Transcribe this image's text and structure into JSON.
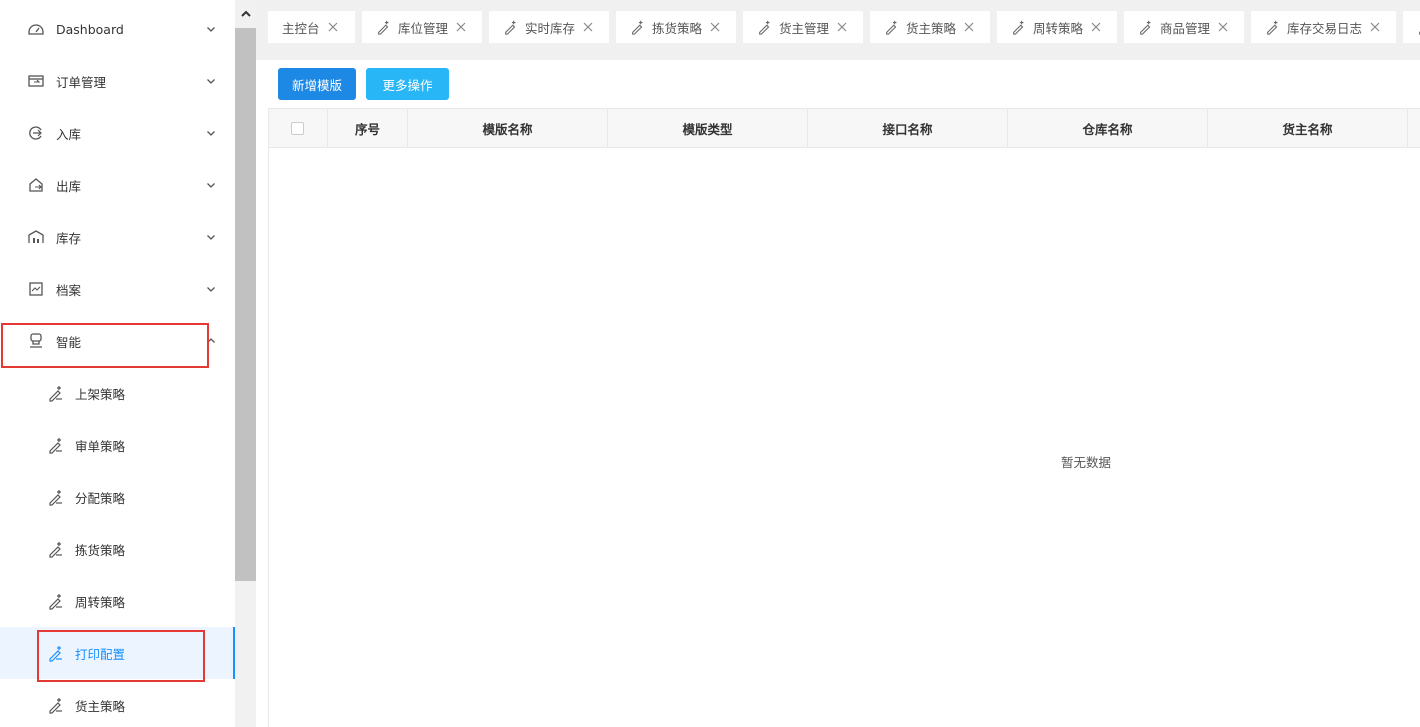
{
  "sidebar": {
    "menu": [
      {
        "label": "Dashboard",
        "icon": "dashboard-icon"
      },
      {
        "label": "订单管理",
        "icon": "order-icon"
      },
      {
        "label": "入库",
        "icon": "inbound-icon"
      },
      {
        "label": "出库",
        "icon": "outbound-icon"
      },
      {
        "label": "库存",
        "icon": "inventory-icon"
      },
      {
        "label": "档案",
        "icon": "archive-icon"
      },
      {
        "label": "智能",
        "icon": "smart-icon"
      }
    ],
    "submenu": [
      {
        "label": "上架策略"
      },
      {
        "label": "审单策略"
      },
      {
        "label": "分配策略"
      },
      {
        "label": "拣货策略"
      },
      {
        "label": "周转策略"
      },
      {
        "label": "打印配置"
      },
      {
        "label": "货主策略"
      }
    ]
  },
  "tabs": [
    {
      "label": "主控台"
    },
    {
      "label": "库位管理"
    },
    {
      "label": "实时库存"
    },
    {
      "label": "拣货策略"
    },
    {
      "label": "货主管理"
    },
    {
      "label": "货主策略"
    },
    {
      "label": "周转策略"
    },
    {
      "label": "商品管理"
    },
    {
      "label": "库存交易日志"
    }
  ],
  "toolbar": {
    "add_label": "新增模版",
    "more_label": "更多操作"
  },
  "table": {
    "columns": [
      "序号",
      "模版名称",
      "模版类型",
      "接口名称",
      "仓库名称",
      "货主名称"
    ],
    "empty_text": "暂无数据"
  },
  "colors": {
    "accent": "#1890ff",
    "primary_button": "#1e88e5",
    "info_button": "#29b6f6",
    "highlight": "#e53935"
  }
}
